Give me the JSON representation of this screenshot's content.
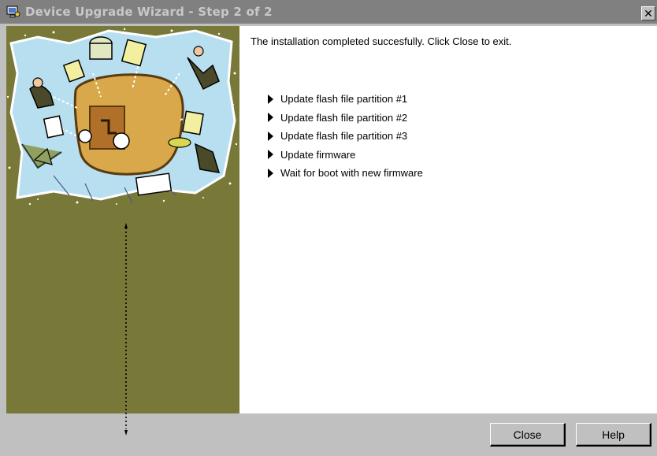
{
  "window": {
    "title": "Device Upgrade Wizard - Step 2 of 2",
    "close_glyph": "✕"
  },
  "content": {
    "message": "The installation completed succesfully.  Click Close to exit.",
    "steps": [
      "Update flash file partition #1",
      "Update flash file partition #2",
      "Update flash file partition #3",
      "Update firmware",
      "Wait for boot with new firmware"
    ]
  },
  "buttons": {
    "close": "Close",
    "help": "Help"
  },
  "colors": {
    "titlebar": "#808080",
    "side_panel": "#787838",
    "dialog_bg": "#c0c0c0"
  }
}
